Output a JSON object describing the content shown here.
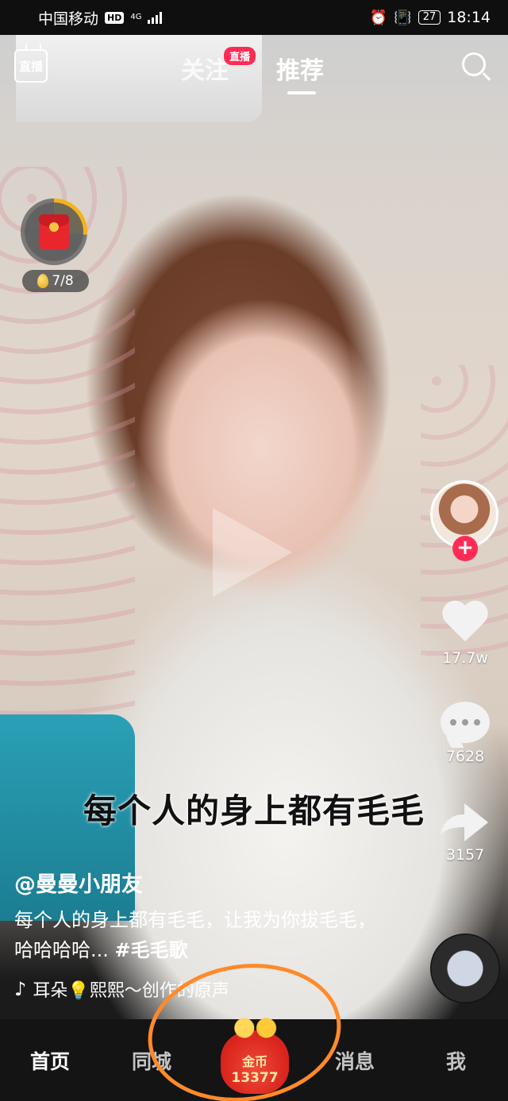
{
  "status_bar": {
    "carrier": "中国移动",
    "hd": "HD",
    "network": "4G",
    "battery": "27",
    "time": "18:14"
  },
  "top_nav": {
    "live_label": "直播",
    "follow_tab": "关注",
    "follow_badge": "直播",
    "recommend_tab": "推荐",
    "active_tab": "推荐"
  },
  "red_packet": {
    "progress": "7/8"
  },
  "right_rail": {
    "likes": "17.7w",
    "comments": "7628",
    "shares": "3157"
  },
  "video": {
    "subtitle": "每个人的身上都有毛毛",
    "author": "@曼曼小朋友",
    "description": "每个人的身上都有毛毛，让我为你拔毛毛，哈哈哈哈...",
    "hashtag": "#毛毛歌",
    "music": "耳朵💡熙熙～创作的原声"
  },
  "bottom_nav": {
    "home": "首页",
    "city": "同城",
    "coin_label": "金币",
    "coin_count": "13377",
    "messages": "消息",
    "me": "我",
    "active": "首页"
  },
  "colors": {
    "accent": "#fe2c55",
    "coin_red": "#d8231c",
    "coin_gold": "#ffe9a3",
    "annotation": "#ff8a2a"
  }
}
